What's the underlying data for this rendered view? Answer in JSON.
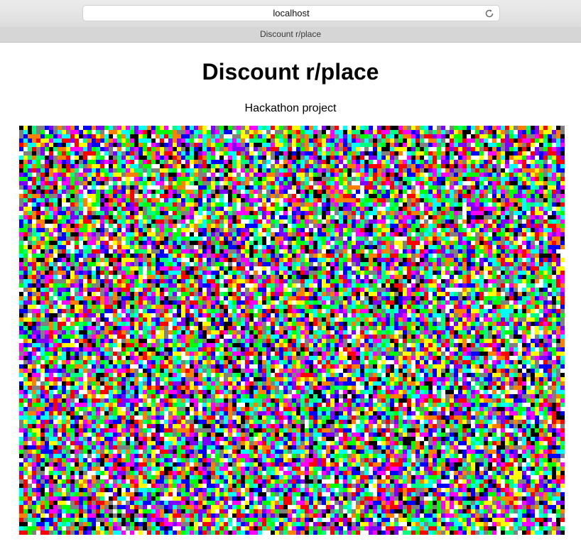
{
  "browser": {
    "address": "localhost",
    "tab_title": "Discount r/place"
  },
  "page": {
    "title": "Discount r/place",
    "subtitle": "Hackathon project"
  },
  "canvas": {
    "palette": [
      "#ff0000",
      "#00ff00",
      "#0000ff",
      "#ffff00",
      "#ff00ff",
      "#00ffff",
      "#ffffff",
      "#000000",
      "#808080",
      "#ff8000",
      "#8000ff",
      "#00ff80"
    ]
  }
}
